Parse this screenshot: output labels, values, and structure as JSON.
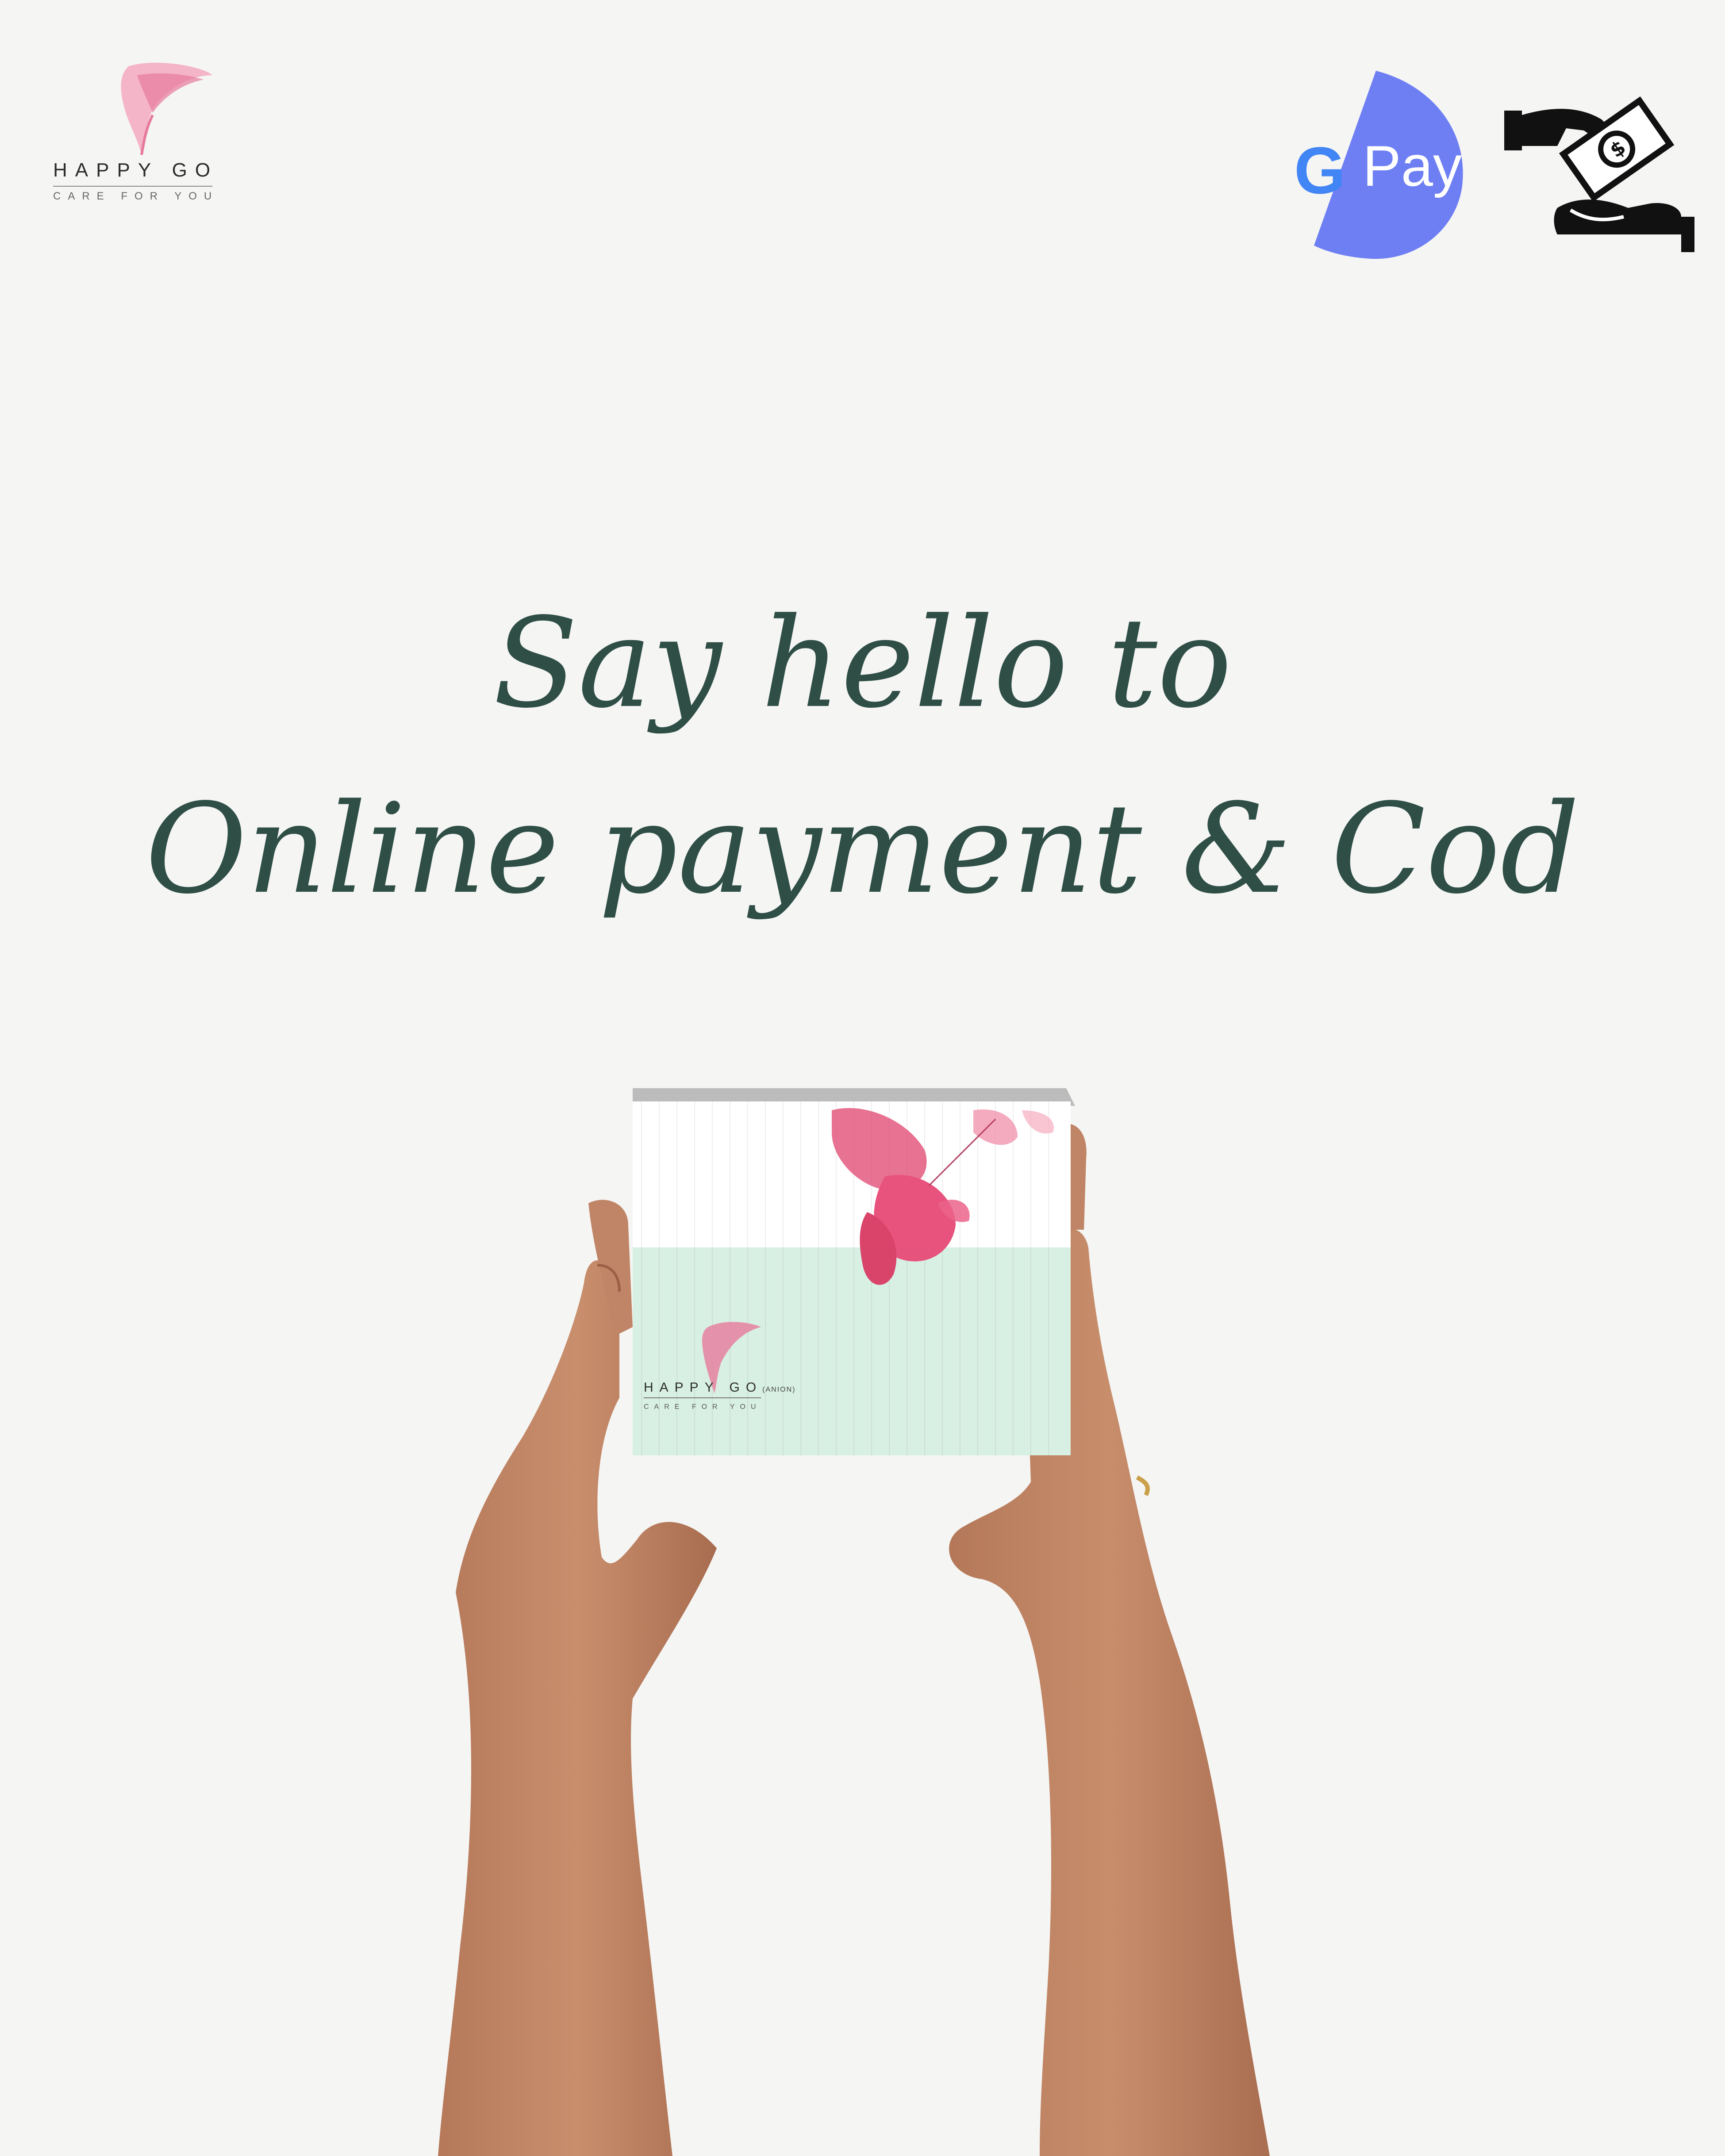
{
  "brand": {
    "name": "HAPPY GO",
    "tagline": "CARE FOR YOU",
    "logo_icon": "calla-lily-icon"
  },
  "payment_icons": {
    "gpay": {
      "g": "G",
      "label": "Pay",
      "icon": "google-pay-icon",
      "color": "#6e7ff3"
    },
    "cod": {
      "icon": "cash-on-delivery-icon"
    }
  },
  "headline": {
    "line1": "Say hello to",
    "line2": "Online payment & Cod",
    "color": "#2f4f46"
  },
  "product": {
    "brand": "HAPPY GO",
    "variant": "(ANION)",
    "tagline": "CARE FOR YOU",
    "accent_color": "#d8efe3",
    "flower_color": "#e0456e"
  }
}
